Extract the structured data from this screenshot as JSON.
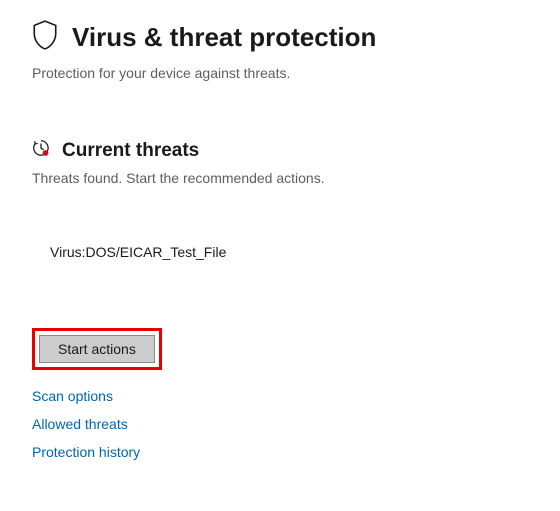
{
  "header": {
    "title": "Virus & threat protection",
    "subtitle": "Protection for your device against threats."
  },
  "section": {
    "title": "Current threats",
    "subtitle": "Threats found. Start the recommended actions."
  },
  "threats": [
    {
      "name": "Virus:DOS/EICAR_Test_File"
    }
  ],
  "action_button": {
    "label": "Start actions"
  },
  "links": [
    {
      "label": "Scan options"
    },
    {
      "label": "Allowed threats"
    },
    {
      "label": "Protection history"
    }
  ]
}
